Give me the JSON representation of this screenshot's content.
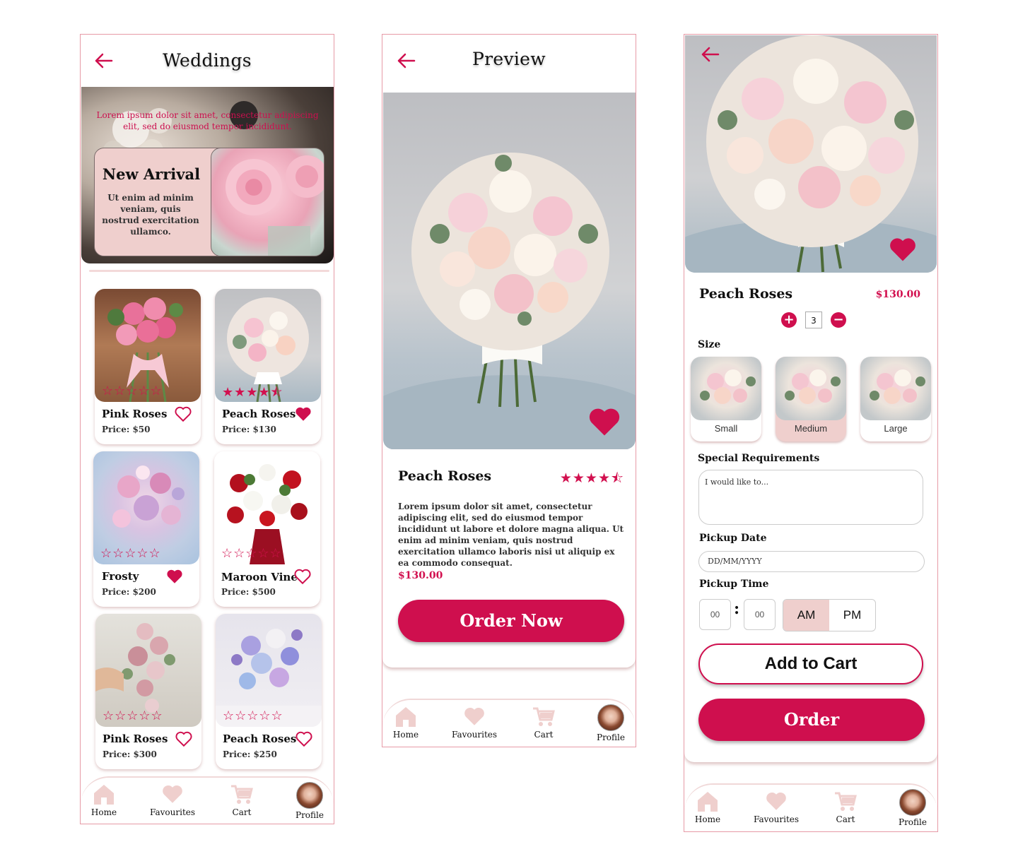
{
  "colors": {
    "accent": "#cf0f4e",
    "soft_pink": "#efcfcd",
    "nav_icon": "#efcfcd",
    "border": "#e69aa6"
  },
  "nav": {
    "home": "Home",
    "favourites": "Favourites",
    "cart": "Cart",
    "profile": "Profile"
  },
  "weddings": {
    "title": "Weddings",
    "banner_text": "Lorem ipsum dolor sit amet, consectetur adipiscing elit, sed do eiusmod tempor incididunt.",
    "new_arrival": {
      "title": "New Arrival",
      "body": "Ut enim ad minim veniam, quis nostrud exercitation ullamco."
    },
    "products": [
      {
        "name": "Pink Roses",
        "price": "Price: $50",
        "stars": "☆☆☆☆☆",
        "favourited": false
      },
      {
        "name": "Peach Roses",
        "price": "Price: $130",
        "stars": "★★★★⯪",
        "favourited": true
      },
      {
        "name": "Frosty",
        "price": "Price: $200",
        "stars": "☆☆☆☆☆",
        "favourited": true
      },
      {
        "name": "Maroon Vine",
        "price": "Price: $500",
        "stars": "☆☆☆☆☆",
        "favourited": false
      },
      {
        "name": "Pink Roses",
        "price": "Price: $300",
        "stars": "☆☆☆☆☆",
        "favourited": false
      },
      {
        "name": "Peach Roses",
        "price": "Price: $250",
        "stars": "☆☆☆☆☆",
        "favourited": false
      }
    ]
  },
  "preview": {
    "title": "Preview",
    "name": "Peach Roses",
    "rating": 4.5,
    "stars": "★★★★⯪",
    "description": "Lorem ipsum dolor sit amet, consectetur adipiscing elit, sed do eiusmod tempor incididunt ut labore et dolore magna aliqua. Ut enim ad minim veniam, quis nostrud exercitation ullamco laboris nisi ut aliquip ex ea commodo consequat.",
    "price": "$130.00",
    "order_label": "Order Now"
  },
  "order": {
    "name": "Peach Roses",
    "price": "$130.00",
    "quantity": "3",
    "plus": "+",
    "minus": "−",
    "size_label": "Size",
    "sizes": [
      "Small",
      "Medium",
      "Large"
    ],
    "selected_size": "Medium",
    "special_label": "Special Requirements",
    "special_placeholder": "I would like to...",
    "pickup_date_label": "Pickup Date",
    "pickup_date_placeholder": "DD/MM/YYYY",
    "pickup_time_label": "Pickup Time",
    "hour": "00",
    "minute": "00",
    "colon": ":",
    "am": "AM",
    "pm": "PM",
    "selected_period": "AM",
    "add_to_cart": "Add to Cart",
    "order_label": "Order"
  }
}
